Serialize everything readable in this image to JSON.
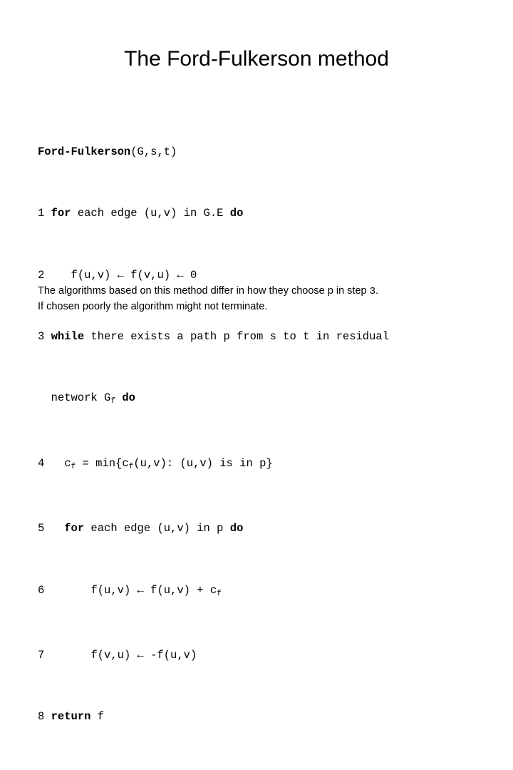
{
  "slide": {
    "title": "The Ford-Fulkerson method",
    "background_color": "#ffffff",
    "text_color": "#000000"
  },
  "pseudocode": {
    "signature": {
      "name": "Ford-Fulkerson",
      "args": "(G,s,t)"
    },
    "lines": [
      {
        "number": "1",
        "indent": "",
        "keyword_pre": "for",
        "text_mid": " each edge (u,v) in G.E ",
        "keyword_post": "do"
      },
      {
        "number": "2",
        "indent": "    ",
        "text": "f(u,v) ← f(v,u) ← 0"
      },
      {
        "number": "3",
        "indent": "",
        "keyword_pre": "while",
        "text_mid": " there exists a path p from s to t in residual"
      },
      {
        "number": "",
        "continuation": "  network G",
        "subscript": "f",
        "continuation_tail": " ",
        "keyword_post": "do"
      },
      {
        "number": "4",
        "indent": "   ",
        "text_a": "c",
        "sub_a": "f",
        "text_b": " = min{c",
        "sub_b": "f",
        "text_c": "(u,v): (u,v) is in p}"
      },
      {
        "number": "5",
        "indent": "   ",
        "keyword_pre": "for",
        "text_mid": " each edge (u,v) in p ",
        "keyword_post": "do"
      },
      {
        "number": "6",
        "indent": "       ",
        "text_a": "f(u,v) ← f(u,v) + c",
        "sub_a": "f"
      },
      {
        "number": "7",
        "indent": "       ",
        "text": "f(v,u) ← -f(u,v)"
      },
      {
        "number": "8",
        "indent": "",
        "keyword_pre": "return",
        "text_mid": " f"
      }
    ]
  },
  "notes": {
    "line1_a": "The algorithms based on this method differ in how they choose p in step ",
    "line1_num": "3",
    "line1_b": ".",
    "line2": "If chosen poorly the algorithm might not terminate."
  }
}
